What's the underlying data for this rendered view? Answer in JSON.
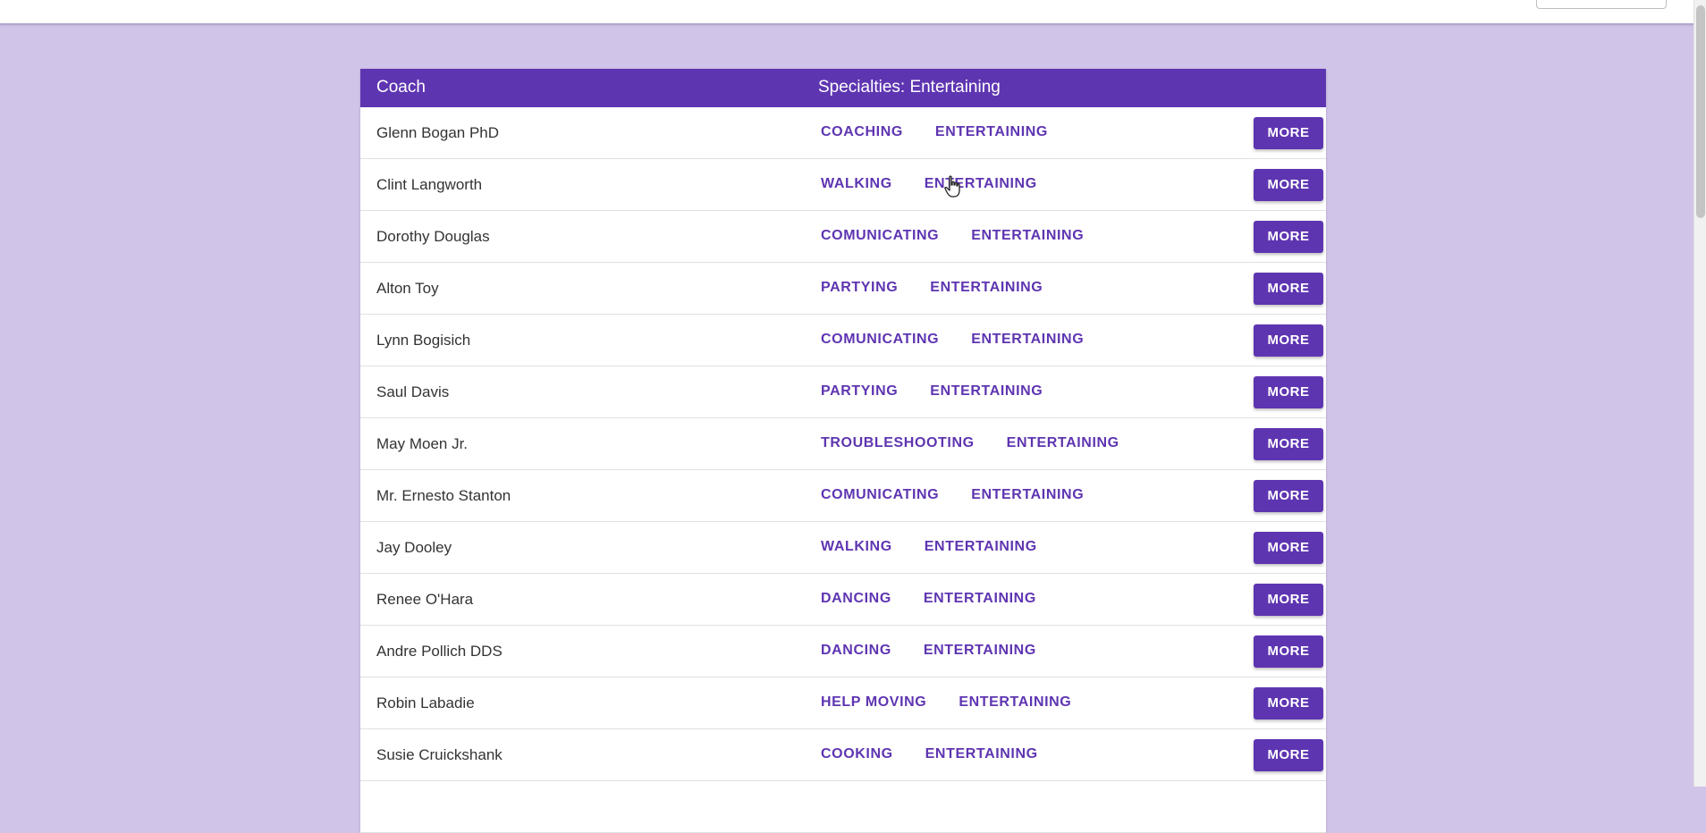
{
  "header": {
    "coach_label": "Coach",
    "specialties_label": "Specialties: Entertaining"
  },
  "rows": [
    {
      "name": "Glenn Bogan PhD",
      "tags": [
        "COACHING",
        "ENTERTAINING"
      ],
      "button": "MORE"
    },
    {
      "name": "Clint Langworth",
      "tags": [
        "WALKING",
        "ENTERTAINING"
      ],
      "button": "MORE"
    },
    {
      "name": "Dorothy Douglas",
      "tags": [
        "COMUNICATING",
        "ENTERTAINING"
      ],
      "button": "MORE"
    },
    {
      "name": "Alton Toy",
      "tags": [
        "PARTYING",
        "ENTERTAINING"
      ],
      "button": "MORE"
    },
    {
      "name": "Lynn Bogisich",
      "tags": [
        "COMUNICATING",
        "ENTERTAINING"
      ],
      "button": "MORE"
    },
    {
      "name": "Saul Davis",
      "tags": [
        "PARTYING",
        "ENTERTAINING"
      ],
      "button": "MORE"
    },
    {
      "name": "May Moen Jr.",
      "tags": [
        "TROUBLESHOOTING",
        "ENTERTAINING"
      ],
      "button": "MORE"
    },
    {
      "name": "Mr. Ernesto Stanton",
      "tags": [
        "COMUNICATING",
        "ENTERTAINING"
      ],
      "button": "MORE"
    },
    {
      "name": "Jay Dooley",
      "tags": [
        "WALKING",
        "ENTERTAINING"
      ],
      "button": "MORE"
    },
    {
      "name": "Renee O'Hara",
      "tags": [
        "DANCING",
        "ENTERTAINING"
      ],
      "button": "MORE"
    },
    {
      "name": "Andre Pollich DDS",
      "tags": [
        "DANCING",
        "ENTERTAINING"
      ],
      "button": "MORE"
    },
    {
      "name": "Robin Labadie",
      "tags": [
        "HELP MOVING",
        "ENTERTAINING"
      ],
      "button": "MORE"
    },
    {
      "name": "Susie Cruickshank",
      "tags": [
        "COOKING",
        "ENTERTAINING"
      ],
      "button": "MORE"
    },
    {
      "name": "",
      "tags": [],
      "button": ""
    }
  ],
  "colors": {
    "page_background": "#d1c4e9",
    "accent": "#5e35b1"
  }
}
